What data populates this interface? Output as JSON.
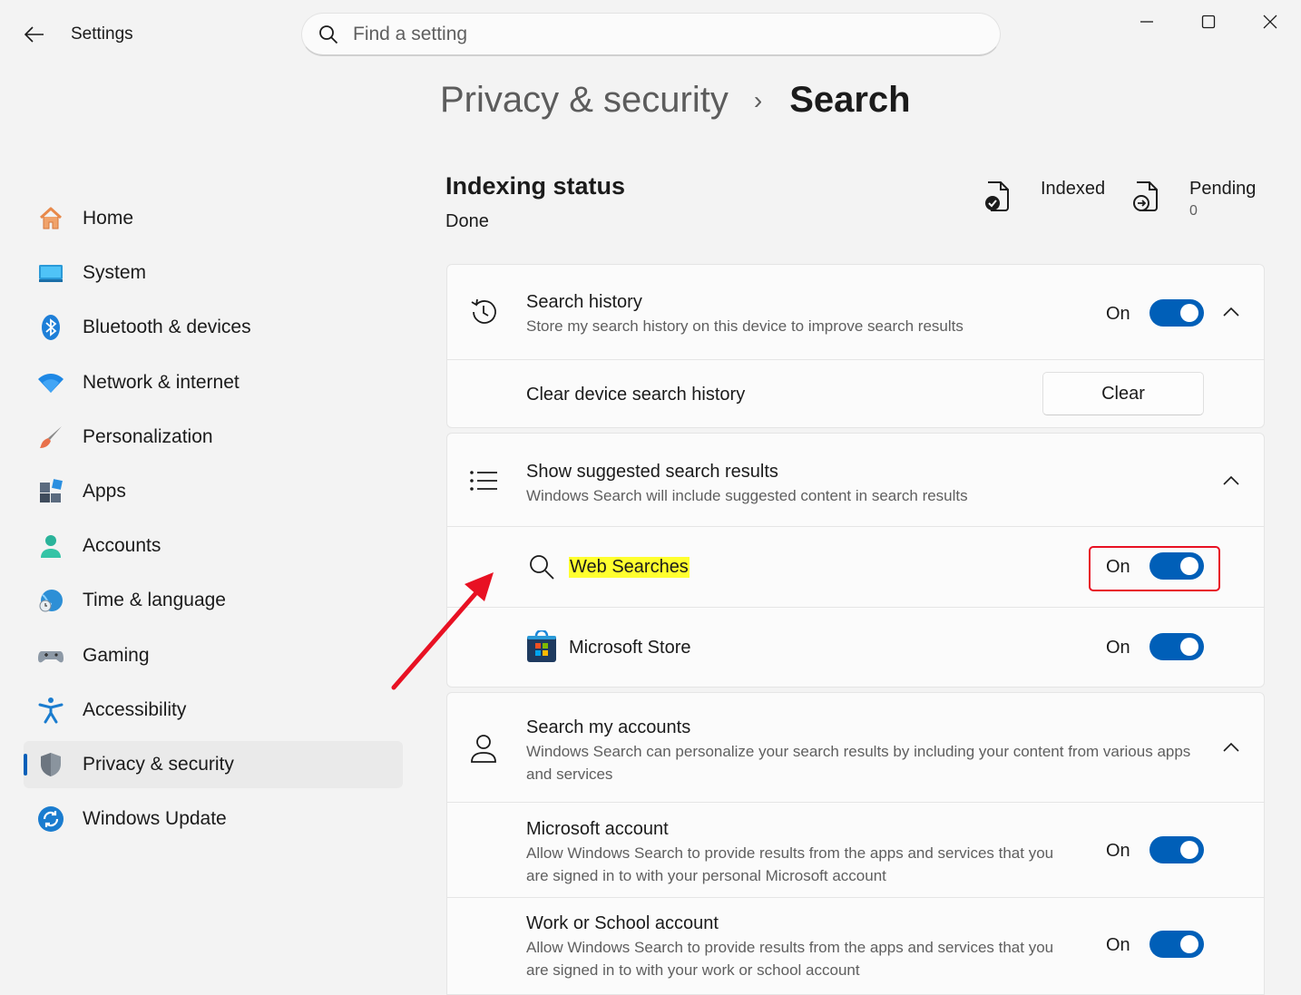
{
  "window": {
    "app_title": "Settings",
    "search_placeholder": "Find a setting"
  },
  "breadcrumb": {
    "parent": "Privacy & security",
    "separator": "›",
    "current": "Search"
  },
  "sidebar": {
    "items": [
      {
        "label": "Home",
        "icon": "home-icon"
      },
      {
        "label": "System",
        "icon": "system-icon"
      },
      {
        "label": "Bluetooth & devices",
        "icon": "bluetooth-icon"
      },
      {
        "label": "Network & internet",
        "icon": "wifi-icon"
      },
      {
        "label": "Personalization",
        "icon": "brush-icon"
      },
      {
        "label": "Apps",
        "icon": "apps-icon"
      },
      {
        "label": "Accounts",
        "icon": "accounts-icon"
      },
      {
        "label": "Time & language",
        "icon": "globe-clock-icon"
      },
      {
        "label": "Gaming",
        "icon": "gamepad-icon"
      },
      {
        "label": "Accessibility",
        "icon": "accessibility-icon"
      },
      {
        "label": "Privacy & security",
        "icon": "shield-icon",
        "active": true
      },
      {
        "label": "Windows Update",
        "icon": "update-icon"
      }
    ]
  },
  "indexing": {
    "title": "Indexing status",
    "status": "Done",
    "indexed_label": "Indexed",
    "pending_label": "Pending",
    "pending_count": "0"
  },
  "search_history": {
    "title": "Search history",
    "description": "Store my search history on this device to improve search results",
    "state": "On",
    "clear_label": "Clear device search history",
    "clear_button": "Clear"
  },
  "suggested": {
    "title": "Show suggested search results",
    "description": "Windows Search will include suggested content in search results",
    "web_searches": {
      "label": "Web Searches",
      "state": "On"
    },
    "microsoft_store": {
      "label": "Microsoft Store",
      "state": "On"
    }
  },
  "accounts": {
    "title": "Search my accounts",
    "description": "Windows Search can personalize your search results by including your content from various apps and services",
    "microsoft_account": {
      "title": "Microsoft account",
      "description": "Allow Windows Search to provide results from the apps and services that you are signed in to with your personal Microsoft account",
      "state": "On"
    },
    "work_school": {
      "title": "Work or School account",
      "description": "Allow Windows Search to provide results from the apps and services that you are signed in to with your work or school account",
      "state": "On"
    }
  },
  "colors": {
    "accent": "#005fb8",
    "highlight": "#ffff2e",
    "annotation_red": "#e81123"
  }
}
